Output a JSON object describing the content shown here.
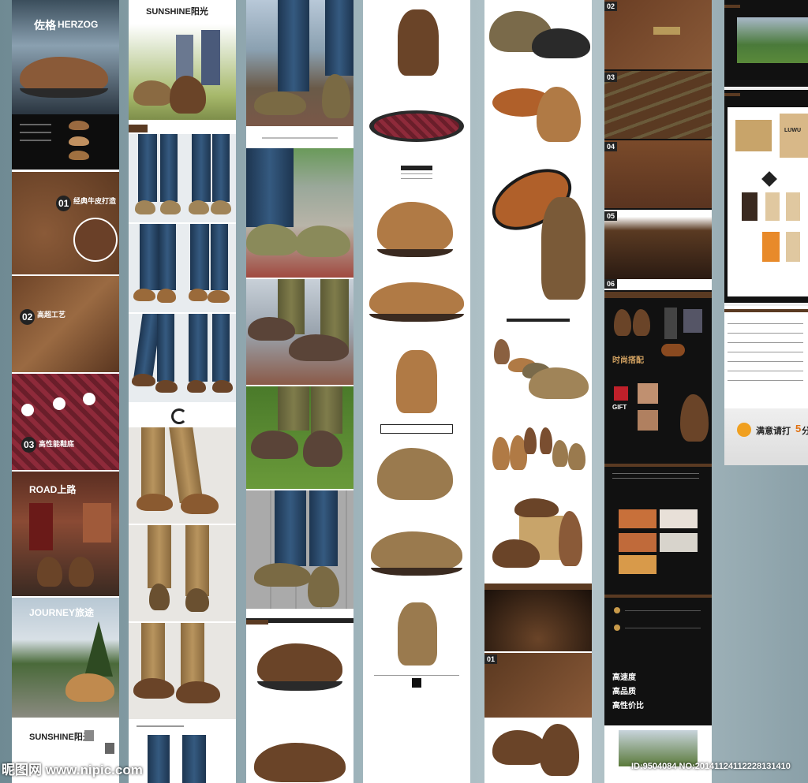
{
  "col1": {
    "brand_cn": "佐格",
    "brand_en": "HERZOG",
    "feature1_num": "01",
    "feature1_title": "经典牛皮打造",
    "feature2_num": "02",
    "feature2_title": "高超工艺",
    "feature3_num": "03",
    "feature3_title": "高性能鞋底",
    "road_title": "ROAD上路",
    "journey_title": "JOURNEY旅途",
    "sunshine_title": "SUNSHINE阳光"
  },
  "col2": {
    "sunshine_title": "SUNSHINE阳光"
  },
  "col5": {
    "fashion_title": "时尚搭配",
    "gift_label": "GIFT",
    "badge_nums": [
      "02",
      "03",
      "04",
      "05",
      "06"
    ]
  },
  "col6": {
    "quality1": "高速度",
    "quality2": "高品质",
    "quality3": "高性价比"
  },
  "col7": {
    "box_logo": "LUWU",
    "rating_prefix": "满意请打",
    "rating_num": "5",
    "rating_suffix": "分"
  },
  "watermark": {
    "site": "昵图网 www.nipic.com",
    "id": "ID:9504084 NO:20141124112228131410"
  },
  "colors": {
    "shoe_brown": "#7a4e30",
    "shoe_tan": "#b07a45",
    "sole_red": "#8e2a3a",
    "panel_dark": "#111111",
    "accent_bar": "#5a3a22"
  }
}
